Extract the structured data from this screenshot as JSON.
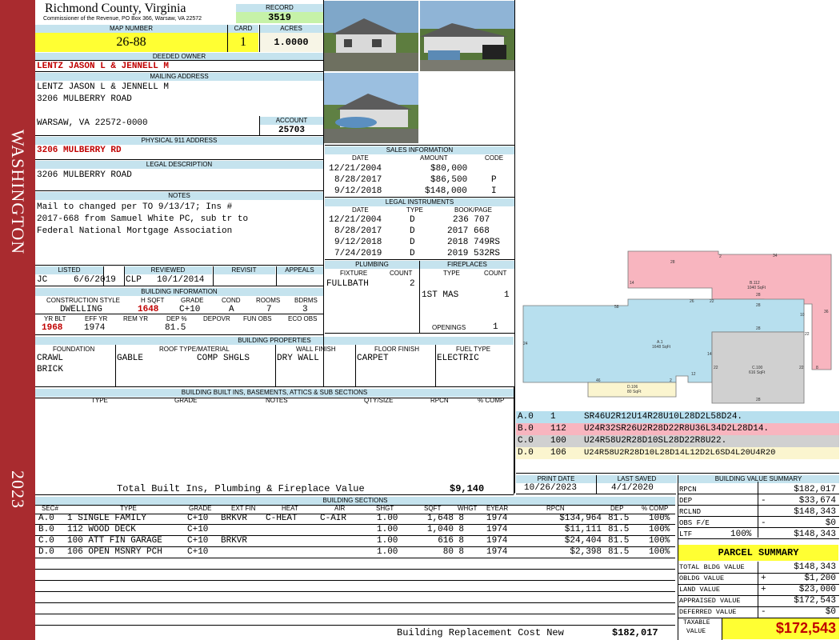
{
  "band": {
    "township": "WASHINGTON",
    "year": "2023"
  },
  "header": {
    "county": "Richmond County, Virginia",
    "commissioner": "Commissioner of the Revenue, PO Box 366, Warsaw, VA 22572"
  },
  "record": {
    "label": "RECORD",
    "value": "3519"
  },
  "map_number": {
    "label": "MAP NUMBER",
    "value": "26-88"
  },
  "card": {
    "label": "CARD",
    "value": "1"
  },
  "acres": {
    "label": "ACRES",
    "value": "1.0000"
  },
  "owner": {
    "label": "DEEDED OWNER",
    "value": "LENTZ JASON L & JENNELL M"
  },
  "mailing": {
    "label": "MAILING ADDRESS",
    "line1": "LENTZ JASON L & JENNELL M",
    "line2": "3206 MULBERRY ROAD",
    "line3": "WARSAW, VA 22572-0000"
  },
  "account": {
    "label": "ACCOUNT",
    "value": "25703"
  },
  "physical": {
    "label": "PHYSICAL 911 ADDRESS",
    "value": "3206 MULBERRY RD"
  },
  "legal_desc": {
    "label": "LEGAL DESCRIPTION",
    "value": "3206 MULBERRY ROAD"
  },
  "notes": {
    "label": "NOTES",
    "line1": "Mail to changed per TO 9/13/17; Ins #",
    "line2": "2017-668 from Samuel White PC, sub tr to",
    "line3": "Federal National Mortgage Association"
  },
  "sales": {
    "title": "SALES INFORMATION",
    "cols": [
      "DATE",
      "AMOUNT",
      "CODE"
    ],
    "rows": [
      [
        "12/21/2004",
        "$80,000",
        ""
      ],
      [
        "8/28/2017",
        "$86,500",
        "P"
      ],
      [
        "9/12/2018",
        "$148,000",
        "I"
      ]
    ]
  },
  "legal_instr": {
    "title": "LEGAL INSTRUMENTS",
    "cols": [
      "DATE",
      "TYPE",
      "BOOK/PAGE"
    ],
    "rows": [
      [
        "12/21/2004",
        "D",
        "236 707"
      ],
      [
        "8/28/2017",
        "D",
        "2017 668"
      ],
      [
        "9/12/2018",
        "D",
        "2018 749RS"
      ],
      [
        "7/24/2019",
        "D",
        "2019 532RS"
      ]
    ]
  },
  "listed": {
    "labels": [
      "LISTED",
      "REVIEWED",
      "REVISIT",
      "APPEALS"
    ],
    "listed_by": "JC",
    "listed_date": "6/6/2019",
    "reviewed_by": "CLP",
    "reviewed_date": "10/1/2014"
  },
  "building_info": {
    "title": "BUILDING INFORMATION",
    "cols1": [
      "CONSTRUCTION STYLE",
      "H SQFT",
      "GRADE",
      "COND",
      "ROOMS",
      "BDRMS"
    ],
    "style": "DWELLING",
    "hsqft": "1648",
    "grade": "C+10",
    "cond": "A",
    "rooms": "7",
    "bdrms": "3",
    "cols2": [
      "YR BLT",
      "EFF YR",
      "REM YR",
      "DEP %",
      "DEPOVR",
      "FUN OBS",
      "ECO OBS"
    ],
    "yrblt": "1968",
    "effyr": "1974",
    "dep": "81.5"
  },
  "plumbing": {
    "title": "PLUMBING",
    "cols": [
      "FIXTURE",
      "COUNT"
    ],
    "fixture": "FULLBATH",
    "count": "2"
  },
  "fireplaces": {
    "title": "FIREPLACES",
    "cols": [
      "TYPE",
      "COUNT"
    ],
    "type": "1ST MAS",
    "count": "1",
    "openings_label": "OPENINGS",
    "openings": "1"
  },
  "bprops": {
    "title": "BUILDING PROPERTIES",
    "cols": [
      "FOUNDATION",
      "ROOF TYPE/MATERIAL",
      "WALL FINISH",
      "FLOOR FINISH",
      "FUEL TYPE"
    ],
    "foundation1": "CRAWL",
    "foundation2": "BRICK",
    "roof_type": "GABLE",
    "roof_mat": "COMP SHGLS",
    "wall": "DRY WALL",
    "floor": "CARPET",
    "fuel": "ELECTRIC"
  },
  "builtins": {
    "title": "BUILDING BUILT INS, BASEMENTS, ATTICS & SUB SECTIONS",
    "cols": [
      "TYPE",
      "GRADE",
      "NOTES",
      "QTY/SIZE",
      "RPCN",
      "% COMP"
    ],
    "total_label": "Total Built Ins, Plumbing & Fireplace Value",
    "total": "$9,140"
  },
  "sketch": {
    "rows": [
      {
        "code": "A.0",
        "num": "1",
        "desc": "SR46U2R12U14R28U10L28D2L58D24."
      },
      {
        "code": "B.0",
        "num": "112",
        "desc": "U24R32SR26U2R28D22R8U36L34D2L28D14."
      },
      {
        "code": "C.0",
        "num": "100",
        "desc": "U24R58U2R28D10SL28D22R8U22."
      },
      {
        "code": "D.0",
        "num": "106",
        "desc": "U24R58U2R28D10L28D14L12D2L6SD4L20U4R20"
      }
    ],
    "labels": {
      "b_name": "B.112",
      "b_area": "1040 SqFt",
      "a_name": "A.1",
      "a_area": "1648 SqFt",
      "c_name": "C.100",
      "c_area": "616 SqFt",
      "d_name": "D.106",
      "d_area": "80 SqFt",
      "n28a": "28",
      "n2": "2",
      "n34": "34",
      "n14": "14",
      "n36": "36",
      "n58": "58",
      "n26": "26",
      "n28b": "28",
      "n24": "24",
      "n22": "22",
      "n8": "8",
      "n12": "12",
      "n46": "46",
      "n10": "10",
      "n28c": "28",
      "n22b": "22",
      "n22c": "22",
      "n28d": "28",
      "n2b": "2",
      "n28e": "28",
      "n14b": "14"
    }
  },
  "dates": {
    "print_label": "PRINT DATE",
    "print": "10/26/2023",
    "saved_label": "LAST SAVED",
    "saved": "4/1/2020"
  },
  "bsections": {
    "title": "BUILDING SECTIONS",
    "cols": [
      "SEC#",
      "TYPE",
      "GRADE",
      "EXT FIN",
      "HEAT",
      "AIR",
      "SHGT",
      "SQFT",
      "WHGT",
      "EYEAR",
      "RPCN",
      "DEP",
      "% COMP"
    ],
    "rows": [
      [
        "A.0",
        "1 SINGLE FAMILY",
        "C+10",
        "BRKVR",
        "C-HEAT",
        "C-AIR",
        "1.00",
        "1,648",
        "8",
        "1974",
        "$134,964",
        "81.5",
        "100%"
      ],
      [
        "B.0",
        "112 WOOD DECK",
        "C+10",
        "",
        "",
        "",
        "1.00",
        "1,040",
        "8",
        "1974",
        "$11,111",
        "81.5",
        "100%"
      ],
      [
        "C.0",
        "100 ATT FIN GARAGE",
        "C+10",
        "BRKVR",
        "",
        "",
        "1.00",
        "616",
        "8",
        "1974",
        "$24,404",
        "81.5",
        "100%"
      ],
      [
        "D.0",
        "106 OPEN MSNRY PCH",
        "C+10",
        "",
        "",
        "",
        "1.00",
        "80",
        "8",
        "1974",
        "$2,398",
        "81.5",
        "100%"
      ]
    ],
    "brcn_label": "Building Replacement Cost New",
    "brcn": "$182,017"
  },
  "bvs": {
    "title": "BUILDING VALUE SUMMARY",
    "rows": [
      [
        "RPCN",
        "",
        "$182,017"
      ],
      [
        "DEP",
        "-",
        "$33,674"
      ],
      [
        "RCLND",
        "",
        "$148,343"
      ],
      [
        "OBS F/E",
        "-",
        "$0"
      ],
      [
        "LTF",
        "100%",
        "$148,343"
      ]
    ]
  },
  "parcel": {
    "title": "PARCEL SUMMARY",
    "rows": [
      [
        "TOTAL BLDG VALUE",
        "",
        "$148,343"
      ],
      [
        "OBLDG VALUE",
        "+",
        "$1,200"
      ],
      [
        "LAND VALUE",
        "+",
        "$23,000"
      ],
      [
        "APPRAISED VALUE",
        "",
        "$172,543"
      ],
      [
        "DEFERRED VALUE",
        "-",
        "$0"
      ]
    ],
    "taxable_label1": "TAXABLE",
    "taxable_label2": "VALUE",
    "taxable": "$172,543"
  },
  "colors": {
    "band": "#a92b2f",
    "header": "#c5e3ee",
    "yellow": "#ffff33",
    "green": "#c6f2a8",
    "sketch_pink": "#f8b5bf",
    "sketch_blue": "#b7dfee",
    "sketch_gray": "#d0d0d0",
    "sketch_cream": "#fbf5cf"
  }
}
